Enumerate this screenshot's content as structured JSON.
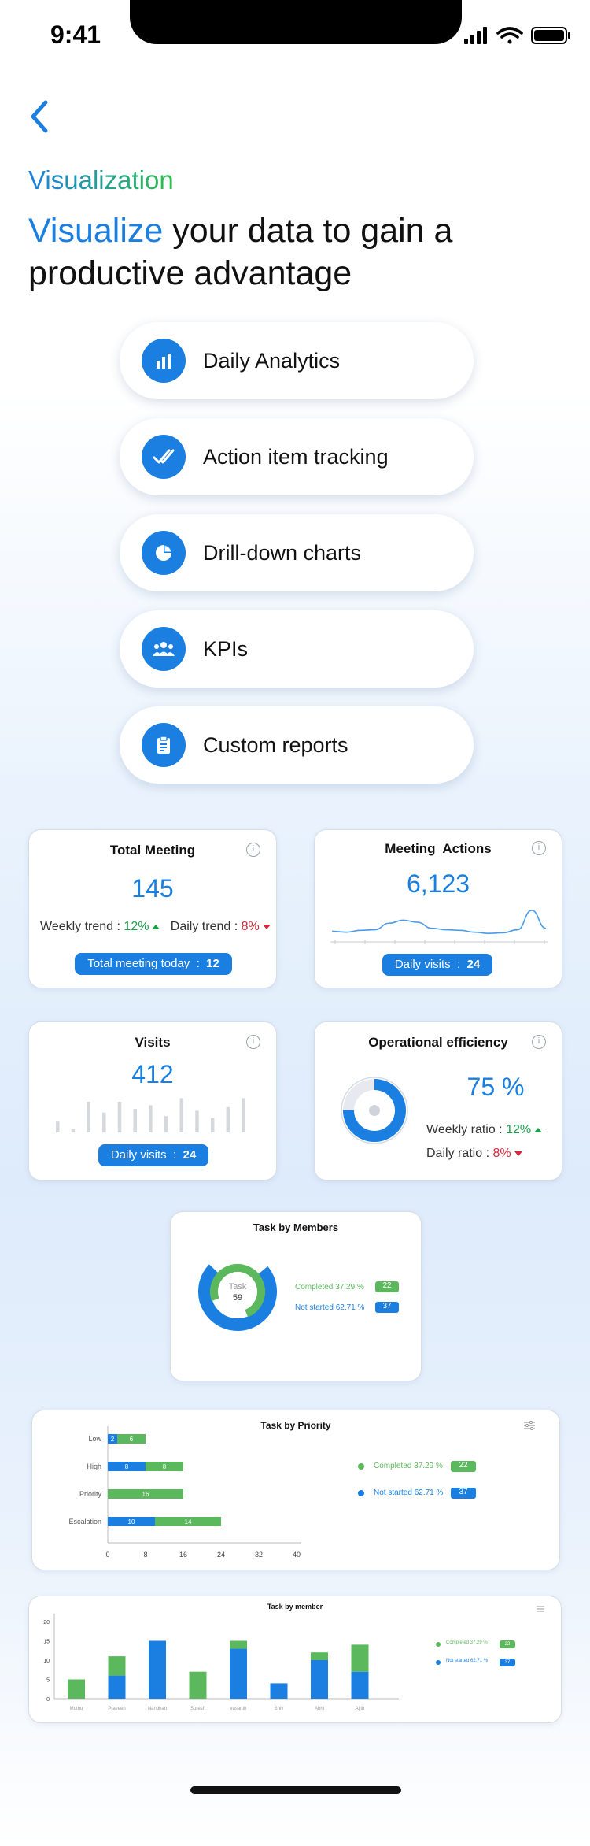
{
  "status": {
    "time": "9:41"
  },
  "header": {
    "kicker": "Visualization",
    "headline_accent": "Visualize",
    "headline_rest": " your data to gain a productive advantage"
  },
  "features": [
    {
      "label": "Daily Analytics",
      "icon": "bar-chart-icon"
    },
    {
      "label": "Action item tracking",
      "icon": "double-check-icon"
    },
    {
      "label": "Drill-down charts",
      "icon": "pie-chart-icon"
    },
    {
      "label": "KPIs",
      "icon": "people-group-icon"
    },
    {
      "label": "Custom reports",
      "icon": "clipboard-icon"
    }
  ],
  "total_meeting": {
    "title": "Total Meeting",
    "value": "145",
    "weekly_label": "Weekly trend",
    "weekly_value": "12%",
    "daily_label": "Daily trend",
    "daily_value": "8%",
    "badge_label": "Total meeting today",
    "badge_value": "12"
  },
  "meeting_actions": {
    "title": "Meeting  Actions",
    "value": "6,123",
    "badge_label": "Daily visits",
    "badge_value": "24"
  },
  "visits": {
    "title": "Visits",
    "value": "412",
    "badge_label": "Daily visits",
    "badge_value": "24",
    "bars": [
      0.3,
      0.1,
      0.85,
      0.55,
      0.85,
      0.65,
      0.75,
      0.45,
      0.95,
      0.6,
      0.4,
      0.7,
      0.95
    ]
  },
  "operational_efficiency": {
    "title": "Operational efficiency",
    "value": "75 %",
    "weekly_label": "Weekly ratio",
    "weekly_value": "12%",
    "daily_label": "Daily ratio",
    "daily_value": "8%",
    "ring_fraction": 0.75
  },
  "task_by_members": {
    "title": "Task by Members",
    "center_label": "Task",
    "center_value": "59",
    "completed_label": "Completed  37.29 %",
    "completed_count": "22",
    "notstarted_label": "Not started  62.71 %",
    "notstarted_count": "37"
  },
  "task_by_priority": {
    "title": "Task by Priority",
    "completed_label": "Completed  37.29 %",
    "completed_count": "22",
    "notstarted_label": "Not started  62.71 %",
    "notstarted_count": "37"
  },
  "task_by_member": {
    "title": "Task by member",
    "completed_label": "Completed  37.29 %",
    "completed_count": "22",
    "notstarted_label": "Not started  62.71 %",
    "notstarted_count": "37"
  },
  "colors": {
    "blue": "#1a7fe0",
    "green": "#5cb85c",
    "up": "#1a9e4a",
    "down": "#d4283a"
  },
  "chart_data": [
    {
      "type": "line",
      "title": "Meeting  Actions",
      "x": [
        1,
        2,
        3,
        4,
        5,
        6,
        7,
        8,
        9,
        10,
        11,
        12,
        13,
        14,
        15,
        16
      ],
      "values": [
        0.25,
        0.22,
        0.28,
        0.3,
        0.52,
        0.62,
        0.55,
        0.35,
        0.3,
        0.28,
        0.22,
        0.18,
        0.2,
        0.3,
        0.95,
        0.35
      ],
      "xlabel": "",
      "ylabel": "",
      "grid": false
    },
    {
      "type": "bar",
      "title": "Task by Priority",
      "orientation": "horizontal",
      "stacked": true,
      "categories": [
        "Low",
        "High",
        "Priority",
        "Escalation"
      ],
      "series": [
        {
          "name": "Not started",
          "color": "#1a7fe0",
          "values": [
            2,
            8,
            0,
            10
          ]
        },
        {
          "name": "Completed",
          "color": "#5cb85c",
          "values": [
            6,
            8,
            16,
            14
          ]
        }
      ],
      "x_ticks": [
        0,
        8,
        16,
        24,
        32,
        40
      ],
      "xlim": [
        0,
        40
      ]
    },
    {
      "type": "bar",
      "title": "Task by member",
      "stacked": true,
      "categories": [
        "Muthu",
        "Praveen",
        "Nandhan",
        "Suresh",
        "vasanth",
        "Shiv",
        "Abhi",
        "Ajith"
      ],
      "series": [
        {
          "name": "Not started",
          "color": "#1a7fe0",
          "values": [
            0,
            6,
            15,
            0,
            13,
            4,
            10,
            7
          ]
        },
        {
          "name": "Completed",
          "color": "#5cb85c",
          "values": [
            5,
            5,
            0,
            7,
            2,
            0,
            2,
            7
          ]
        }
      ],
      "y_ticks": [
        0,
        5,
        10,
        15,
        20
      ],
      "ylim": [
        0,
        20
      ]
    }
  ]
}
